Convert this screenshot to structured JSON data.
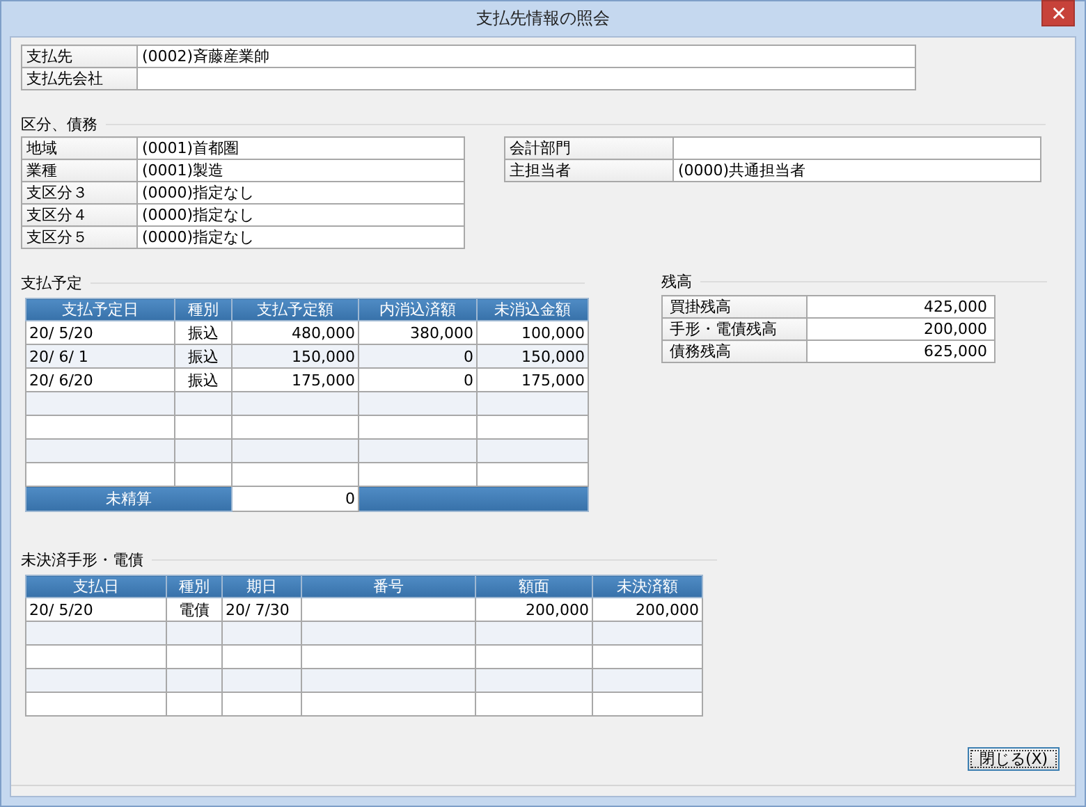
{
  "window": {
    "title": "支払先情報の照会"
  },
  "vendor_fields": [
    {
      "label": "支払先",
      "value": "(0002)斉藤産業帥"
    },
    {
      "label": "支払先会社"
    }
  ],
  "classification": {
    "title": "区分、債務",
    "left": [
      {
        "label": "地域",
        "value": "(0001)首都圏"
      },
      {
        "label": "業種",
        "value": "(0001)製造"
      },
      {
        "label": "支区分３",
        "value": "(0000)指定なし"
      },
      {
        "label": "支区分４",
        "value": "(0000)指定なし"
      },
      {
        "label": "支区分５",
        "value": "(0000)指定なし"
      }
    ],
    "right": [
      {
        "label": "会計部門"
      },
      {
        "label": "主担当者",
        "value": "(0000)共通担当者"
      }
    ]
  },
  "payment_schedule": {
    "title": "支払予定",
    "columns": [
      {
        "label": "支払予定日",
        "kind": "date"
      },
      {
        "label": "種別",
        "kind": "type"
      },
      {
        "label": "支払予定額",
        "kind": "amount"
      },
      {
        "label": "内消込済額",
        "kind": "amount"
      },
      {
        "label": "未消込金額",
        "kind": "amount"
      }
    ],
    "rows": [
      [
        "20/ 5/20",
        "振込",
        "480,000",
        "380,000",
        "100,000"
      ],
      [
        "20/ 6/ 1",
        "振込",
        "150,000",
        "0",
        "150,000"
      ],
      [
        "20/ 6/20",
        "振込",
        "175,000",
        "0",
        "175,000"
      ]
    ],
    "footer": {
      "label": "未精算",
      "value": "0"
    }
  },
  "balances": {
    "title": "残高",
    "rows": [
      {
        "label": "買掛残高",
        "value": "425,000"
      },
      {
        "label": "手形・電債残高",
        "value": "200,000"
      },
      {
        "label": "債務残高",
        "value": "625,000"
      }
    ]
  },
  "unsettled_bills": {
    "title": "未決済手形・電債",
    "columns": [
      {
        "label": "支払日",
        "kind": "date"
      },
      {
        "label": "種別",
        "kind": "type"
      },
      {
        "label": "期日",
        "kind": "date"
      },
      {
        "label": "番号",
        "kind": "text"
      },
      {
        "label": "額面",
        "kind": "amount"
      },
      {
        "label": "未決済額",
        "kind": "amount"
      }
    ],
    "rows": [
      [
        "20/ 5/20",
        "電債",
        "20/ 7/30",
        null,
        "200,000",
        "200,000"
      ]
    ]
  },
  "buttons": [
    {
      "label": "閉じる(X)",
      "focused": true
    }
  ]
}
